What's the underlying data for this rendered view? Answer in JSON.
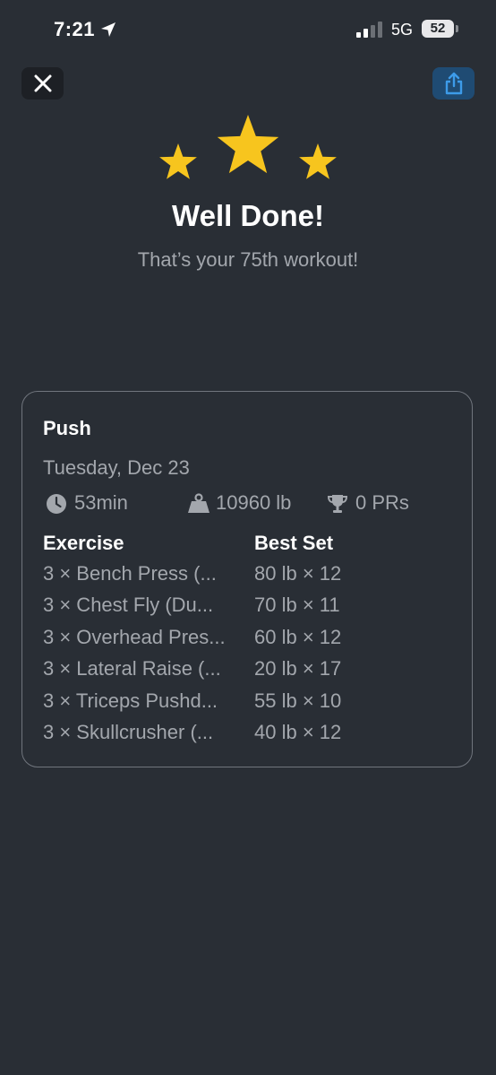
{
  "status_bar": {
    "time": "7:21",
    "network": "5G",
    "battery": "52"
  },
  "toolbar": {
    "close_icon": "close-icon",
    "share_icon": "share-icon"
  },
  "celebration": {
    "star_color": "#f7c51e",
    "headline": "Well Done!",
    "subheadline": "That’s your 75th workout!"
  },
  "workout": {
    "title": "Push",
    "date": "Tuesday, Dec 23",
    "stats": {
      "duration": "53min",
      "volume": "10960 lb",
      "prs": "0 PRs"
    },
    "columns": {
      "exercise": "Exercise",
      "best_set": "Best Set"
    },
    "exercises": [
      {
        "name": "3 × Bench Press (...",
        "best_set": "80 lb × 12"
      },
      {
        "name": "3 × Chest Fly (Du...",
        "best_set": "70 lb × 11"
      },
      {
        "name": "3 × Overhead Pres...",
        "best_set": "60 lb × 12"
      },
      {
        "name": "3 × Lateral Raise (...",
        "best_set": "20 lb × 17"
      },
      {
        "name": "3 × Triceps Pushd...",
        "best_set": "55 lb × 10"
      },
      {
        "name": "3 × Skullcrusher (...",
        "best_set": "40 lb × 12"
      }
    ]
  },
  "colors": {
    "background": "#292e35",
    "secondary_text": "#a3a7ad",
    "share_accent": "#3d9be9"
  }
}
